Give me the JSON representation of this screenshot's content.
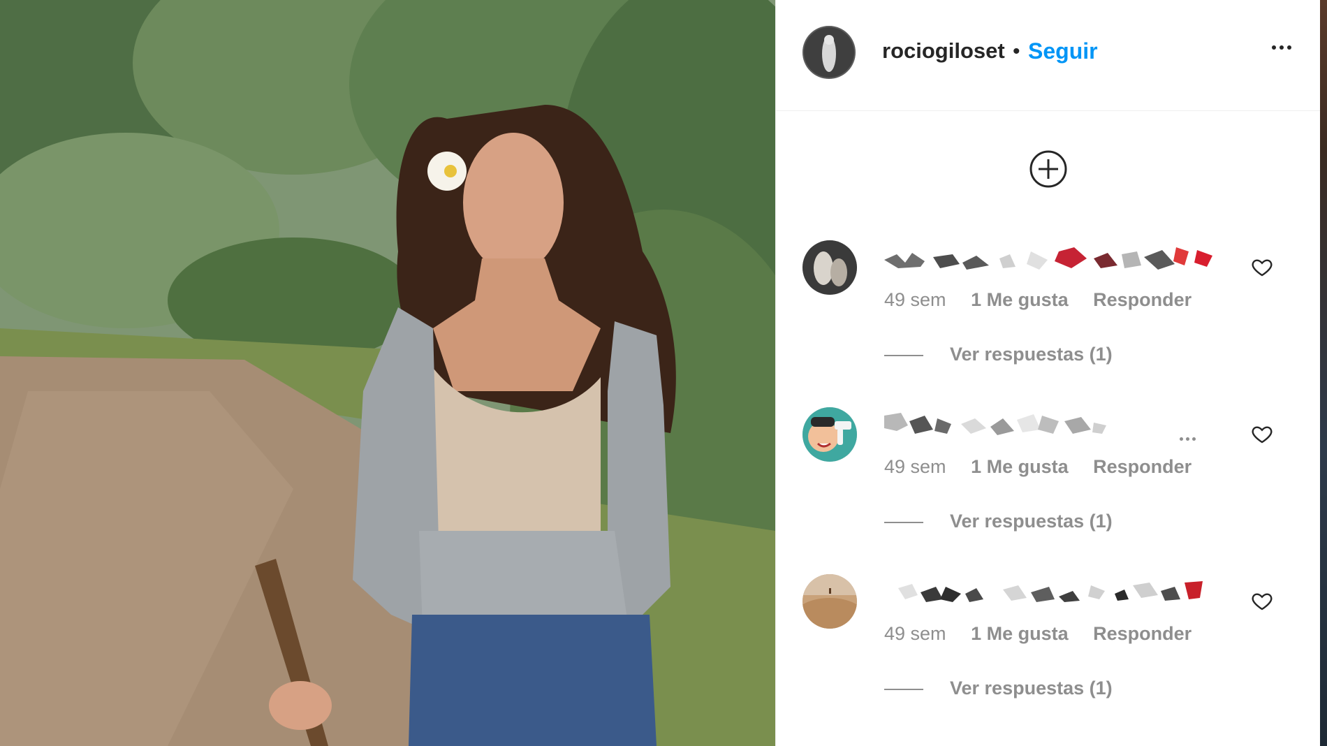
{
  "post": {
    "username": "rociogiloset",
    "separator": "•",
    "follow_label": "Seguir",
    "more_icon": "more-horizontal-icon",
    "add_icon": "plus-circle-icon"
  },
  "comments": [
    {
      "avatar_icon": "avatar-dark-figure",
      "time": "49 sem",
      "likes": "1 Me gusta",
      "reply_label": "Responder",
      "view_replies": "Ver respuestas (1)",
      "has_options": false
    },
    {
      "avatar_icon": "avatar-cartoon-person",
      "time": "49 sem",
      "likes": "1 Me gusta",
      "reply_label": "Responder",
      "view_replies": "Ver respuestas (1)",
      "has_options": true
    },
    {
      "avatar_icon": "avatar-desert",
      "time": "49 sem",
      "likes": "1 Me gusta",
      "reply_label": "Responder",
      "view_replies": "Ver respuestas (1)",
      "has_options": false
    }
  ],
  "colors": {
    "follow": "#0095f6",
    "text_primary": "#262626",
    "text_secondary": "#8e8e8e"
  }
}
